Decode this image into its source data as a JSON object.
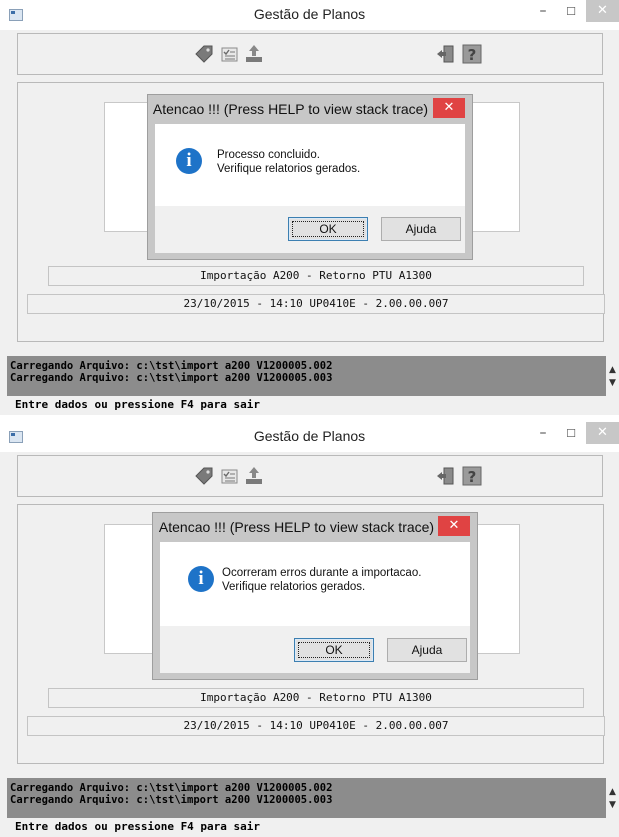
{
  "windows": [
    {
      "title": "Gestão de Planos",
      "controls": {
        "minimize": "–",
        "maximize": "☐",
        "close": "✕"
      },
      "toolbar_icons": [
        "tag-icon",
        "checklist-icon",
        "upload-icon",
        "exit-door-icon",
        "help-icon"
      ],
      "label_import": "Importação A200 - Retorno PTU A1300",
      "label_status": "23/10/2015 - 14:10  UP0410E - 2.00.00.007",
      "log_lines": [
        "Carregando Arquivo: c:\\tst\\import a200 V1200005.002",
        "Carregando Arquivo: c:\\tst\\import a200 V1200005.003"
      ],
      "prompt": "Entre dados ou pressione F4 para sair",
      "dialog": {
        "title": "Atencao !!! (Press HELP to view stack trace)",
        "close": "✕",
        "icon": "i",
        "message_line1": "Processo concluido.",
        "message_line2": "Verifique relatorios gerados.",
        "ok_label": "OK",
        "help_label": "Ajuda"
      }
    },
    {
      "title": "Gestão de Planos",
      "controls": {
        "minimize": "–",
        "maximize": "☐",
        "close": "✕"
      },
      "toolbar_icons": [
        "tag-icon",
        "checklist-icon",
        "upload-icon",
        "exit-door-icon",
        "help-icon"
      ],
      "label_import": "Importação A200 - Retorno PTU A1300",
      "label_status": "23/10/2015 - 14:10  UP0410E - 2.00.00.007",
      "log_lines": [
        "Carregando Arquivo: c:\\tst\\import a200 V1200005.002",
        "Carregando Arquivo: c:\\tst\\import a200 V1200005.003"
      ],
      "prompt": "Entre dados ou pressione F4 para sair",
      "dialog": {
        "title": "Atencao !!! (Press HELP to view stack trace)",
        "close": "✕",
        "icon": "i",
        "message_line1": "Ocorreram erros durante a importacao.",
        "message_line2": "Verifique relatorios gerados.",
        "ok_label": "OK",
        "help_label": "Ajuda"
      }
    }
  ]
}
